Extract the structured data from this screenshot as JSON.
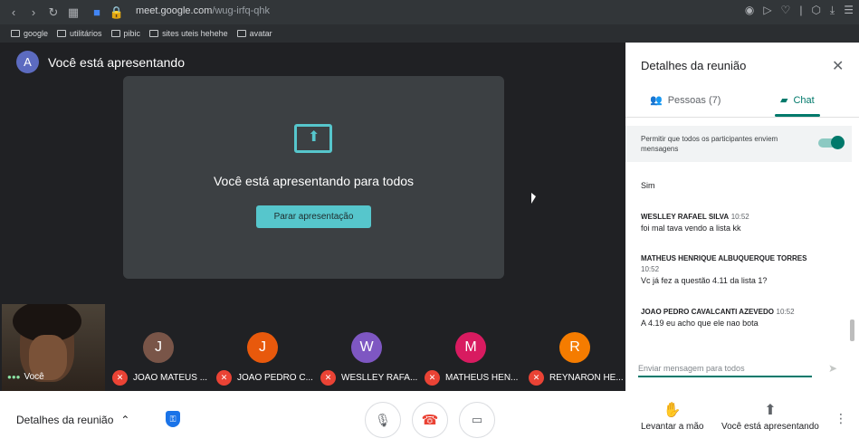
{
  "browser": {
    "url_host": "meet.google.com",
    "url_path": "/wug-irfq-qhk",
    "bookmarks": [
      "google",
      "utilitários",
      "pibic",
      "sites uteis hehehe",
      "avatar"
    ]
  },
  "presenter": {
    "avatar_letter": "A",
    "title": "Você está apresentando"
  },
  "share": {
    "message": "Você está apresentando para todos",
    "stop_button": "Parar apresentação"
  },
  "self": {
    "name": "Você"
  },
  "participants": [
    {
      "letter": "J",
      "name": "JOAO MATEUS ...",
      "color": "#795548"
    },
    {
      "letter": "J",
      "name": "JOAO PEDRO C...",
      "color": "#e8590c"
    },
    {
      "letter": "W",
      "name": "WESLLEY RAFA...",
      "color": "#7e57c2"
    },
    {
      "letter": "M",
      "name": "MATHEUS HEN...",
      "color": "#d81b60"
    },
    {
      "letter": "R",
      "name": "REYNARON HE...",
      "color": "#f57c00"
    }
  ],
  "panel": {
    "title": "Detalhes da reunião",
    "tab_people": "Pessoas (7)",
    "tab_chat": "Chat",
    "permit_text": "Permitir que todos os participantes enviem mensagens",
    "messages": [
      {
        "who": "",
        "time": "",
        "text": "Sim"
      },
      {
        "who": "WESLLEY RAFAEL SILVA",
        "time": "10:52",
        "text": "foi mal tava vendo a lista kk"
      },
      {
        "who": "MATHEUS HENRIQUE ALBUQUERQUE TORRES",
        "time": "10:52",
        "text": "Vc já fez a questão 4.11 da lista 1?"
      },
      {
        "who": "JOAO PEDRO CAVALCANTI AZEVEDO",
        "time": "10:52",
        "text": "A 4.19 eu acho que ele nao bota"
      }
    ],
    "input_placeholder": "Enviar mensagem para todos"
  },
  "bottom": {
    "details_label": "Detalhes da reunião",
    "raise_hand": "Levantar a mão",
    "presenting": "Você está apresentando"
  },
  "colors": {
    "accent": "#00796b",
    "share_accent": "#56c6cc",
    "end_call": "#ea4335"
  },
  "icons": [
    "back-icon",
    "forward-icon",
    "reload-icon",
    "apps-icon",
    "camera-icon",
    "lock-icon",
    "screen-share-icon",
    "close-icon",
    "people-icon",
    "chat-icon",
    "send-icon",
    "shield-icon",
    "mic-icon",
    "end-call-icon",
    "video-icon",
    "hand-icon",
    "present-icon",
    "more-icon",
    "mic-off-icon"
  ]
}
